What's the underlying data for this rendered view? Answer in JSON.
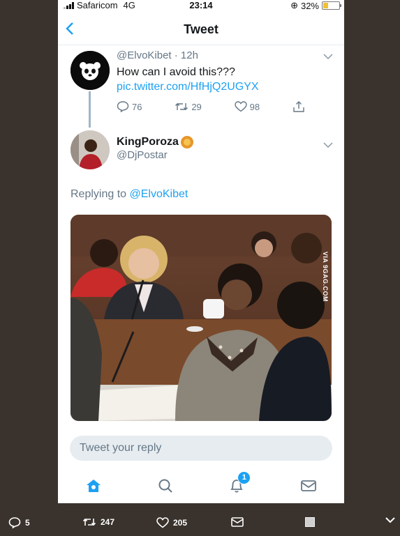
{
  "status_bar": {
    "carrier": "Safaricom",
    "network": "4G",
    "time": "23:14",
    "battery": "32%",
    "battery_level": 0.32
  },
  "nav": {
    "title": "Tweet"
  },
  "original_tweet": {
    "handle_time": "@ElvoKibet · 12h",
    "text": "How can I avoid this??? ",
    "link_text": "pic.twitter.com/HfHjQ2UGYX",
    "replies": "76",
    "retweets": "29",
    "likes": "98"
  },
  "reply_tweet": {
    "display_name": "KingPoroza",
    "handle": "@DjPostar",
    "replying_prefix": "Replying to ",
    "replying_to": "@ElvoKibet",
    "media_watermark": "VIA 9GAG.COM"
  },
  "composer": {
    "placeholder": "Tweet your reply"
  },
  "tabs": {
    "notifications_badge": "1"
  },
  "outer_actions": {
    "replies": "5",
    "retweets": "247",
    "likes": "205"
  },
  "colors": {
    "accent": "#1da1f2",
    "background": "#3a332d"
  },
  "icons": [
    "back-arrow-icon",
    "panda-avatar-icon",
    "reply-icon",
    "retweet-icon",
    "like-icon",
    "share-icon",
    "lion-emoji-icon",
    "chevron-down-icon",
    "home-icon",
    "search-icon",
    "bell-icon",
    "mail-icon"
  ]
}
